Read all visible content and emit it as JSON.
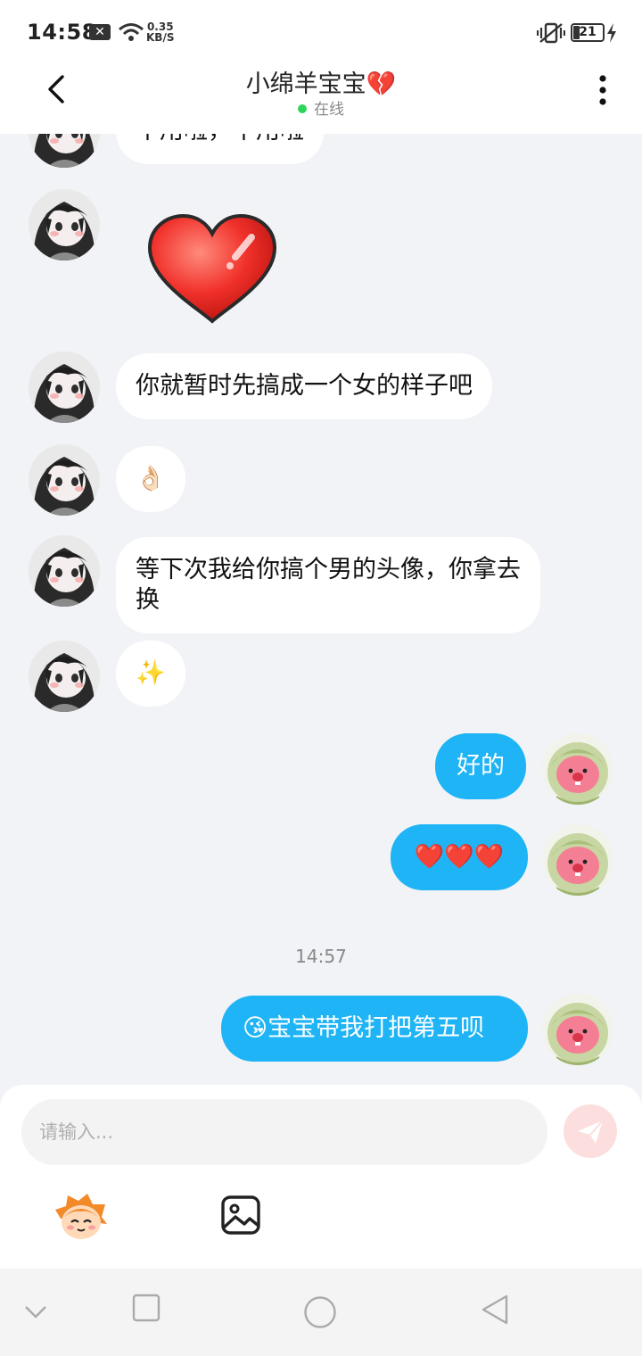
{
  "status_bar": {
    "time": "14:58",
    "notif_badge": "✕",
    "net_speed_value": "0.35",
    "net_speed_unit": "KB/S",
    "battery": "21"
  },
  "header": {
    "title": "小绵羊宝宝💔",
    "status": "在线"
  },
  "messages": [
    {
      "side": "in",
      "type": "text",
      "text": "不用啦，不用啦"
    },
    {
      "side": "in",
      "type": "sticker",
      "sticker": "red-heart"
    },
    {
      "side": "in",
      "type": "text",
      "text": "你就暂时先搞成一个女的样子吧"
    },
    {
      "side": "in",
      "type": "emoji",
      "text": "👌🏻"
    },
    {
      "side": "in",
      "type": "text",
      "text": "等下次我给你搞个男的头像，你拿去换"
    },
    {
      "side": "in",
      "type": "emoji",
      "text": "✨"
    },
    {
      "side": "out",
      "type": "text",
      "text": "好的"
    },
    {
      "side": "out",
      "type": "text",
      "text": "❤️❤️❤️"
    },
    {
      "side": "out",
      "type": "text",
      "text": "😘宝宝带我打把第五呗"
    }
  ],
  "time_separator": "14:57",
  "composer": {
    "placeholder": "请输入..."
  },
  "icons": {
    "back": "chevron-left-icon",
    "more": "more-vertical-icon",
    "send": "send-plane-icon",
    "emoji": "emoji-face-icon",
    "image": "image-icon",
    "nav": [
      "collapse-icon",
      "recents-icon",
      "home-icon",
      "back-triangle-icon"
    ]
  },
  "colors": {
    "outgoing_bubble": "#1fb4f5",
    "incoming_bubble": "#ffffff",
    "chat_background": "#f1f3f6",
    "online_dot": "#2fd45a",
    "send_button": "#fbdedd"
  }
}
